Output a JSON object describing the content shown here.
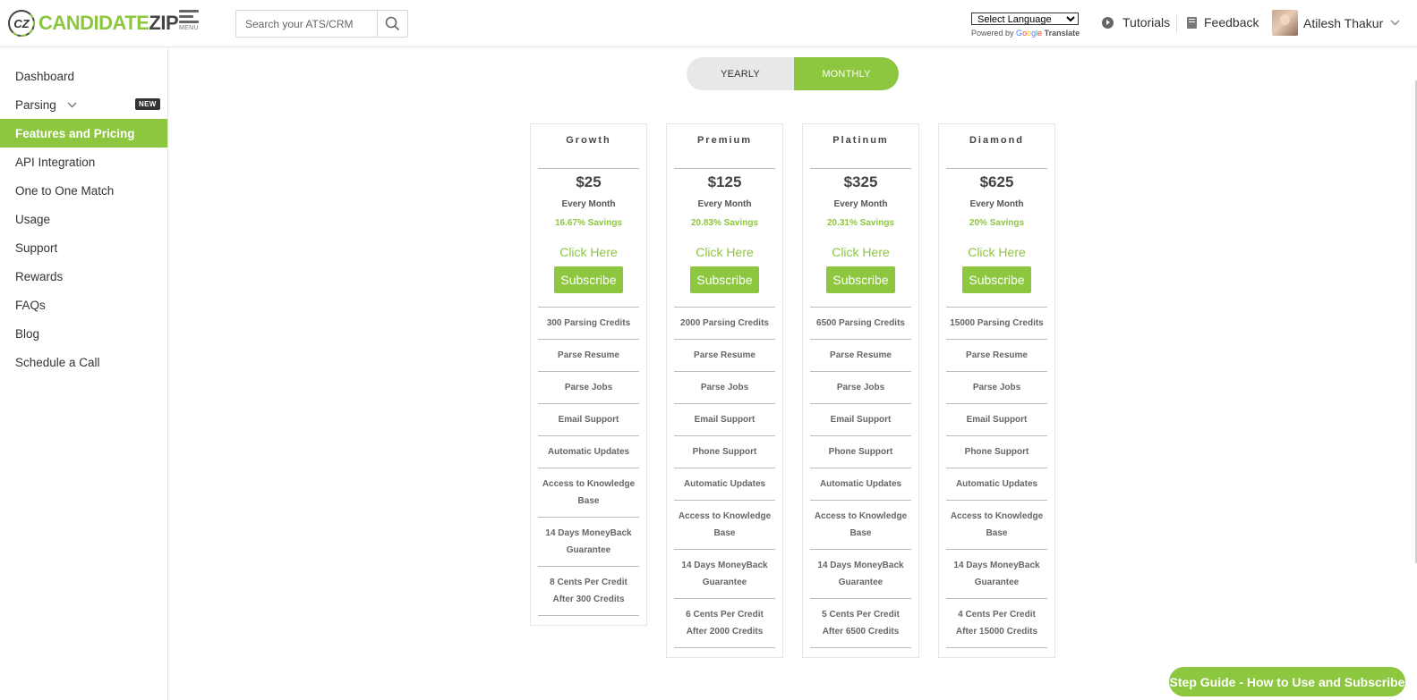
{
  "header": {
    "logo_text_part1": "CANDIDATE",
    "logo_text_part2": "ZIP",
    "logo_mark": "CZ",
    "menu_label": "MENU",
    "search_placeholder": "Search your ATS/CRM",
    "language_select": "Select Language",
    "powered_by": "Powered by",
    "translate_label": "Translate",
    "tutorials": "Tutorials",
    "feedback": "Feedback",
    "user_name": "Atilesh Thakur"
  },
  "sidebar": {
    "items": [
      {
        "label": "Dashboard"
      },
      {
        "label": "Parsing",
        "badge": "NEW"
      },
      {
        "label": "Features and Pricing",
        "active": true
      },
      {
        "label": "API Integration"
      },
      {
        "label": "One to One Match"
      },
      {
        "label": "Usage"
      },
      {
        "label": "Support"
      },
      {
        "label": "Rewards"
      },
      {
        "label": "FAQs"
      },
      {
        "label": "Blog"
      },
      {
        "label": "Schedule a Call"
      }
    ]
  },
  "billing_toggle": {
    "yearly": "YEARLY",
    "monthly": "MONTHLY",
    "selected": "MONTHLY"
  },
  "plans": [
    {
      "name": "Growth",
      "price": "$25",
      "period": "Every Month",
      "savings": "16.67% Savings",
      "click_here": "Click Here",
      "subscribe": "Subscribe",
      "features": [
        "300 Parsing Credits",
        "Parse Resume",
        "Parse Jobs",
        "Email Support",
        "Automatic Updates",
        "Access to Knowledge Base",
        "14 Days MoneyBack Guarantee",
        "8 Cents Per Credit After 300 Credits"
      ]
    },
    {
      "name": "Premium",
      "price": "$125",
      "period": "Every Month",
      "savings": "20.83% Savings",
      "click_here": "Click Here",
      "subscribe": "Subscribe",
      "features": [
        "2000 Parsing Credits",
        "Parse Resume",
        "Parse Jobs",
        "Email Support",
        "Phone Support",
        "Automatic Updates",
        "Access to Knowledge Base",
        "14 Days MoneyBack Guarantee",
        "6 Cents Per Credit After 2000 Credits"
      ]
    },
    {
      "name": "Platinum",
      "price": "$325",
      "period": "Every Month",
      "savings": "20.31% Savings",
      "click_here": "Click Here",
      "subscribe": "Subscribe",
      "features": [
        "6500 Parsing Credits",
        "Parse Resume",
        "Parse Jobs",
        "Email Support",
        "Phone Support",
        "Automatic Updates",
        "Access to Knowledge Base",
        "14 Days MoneyBack Guarantee",
        "5 Cents Per Credit After 6500 Credits"
      ]
    },
    {
      "name": "Diamond",
      "price": "$625",
      "period": "Every Month",
      "savings": "20% Savings",
      "click_here": "Click Here",
      "subscribe": "Subscribe",
      "features": [
        "15000 Parsing Credits",
        "Parse Resume",
        "Parse Jobs",
        "Email Support",
        "Phone Support",
        "Automatic Updates",
        "Access to Knowledge Base",
        "14 Days MoneyBack Guarantee",
        "4 Cents Per Credit After 15000 Credits"
      ]
    }
  ],
  "guide_button": "Step Guide - How to Use and Subscribe",
  "colors": {
    "accent": "#8dc63f",
    "text": "#333333",
    "badge": "#333333"
  },
  "icons": {
    "search": "search-icon",
    "menu": "hamburger-menu-icon",
    "tutorials": "play-circle-icon",
    "feedback": "book-icon",
    "user_menu": "chevron-down-icon",
    "parsing_expand": "chevron-down-icon"
  }
}
